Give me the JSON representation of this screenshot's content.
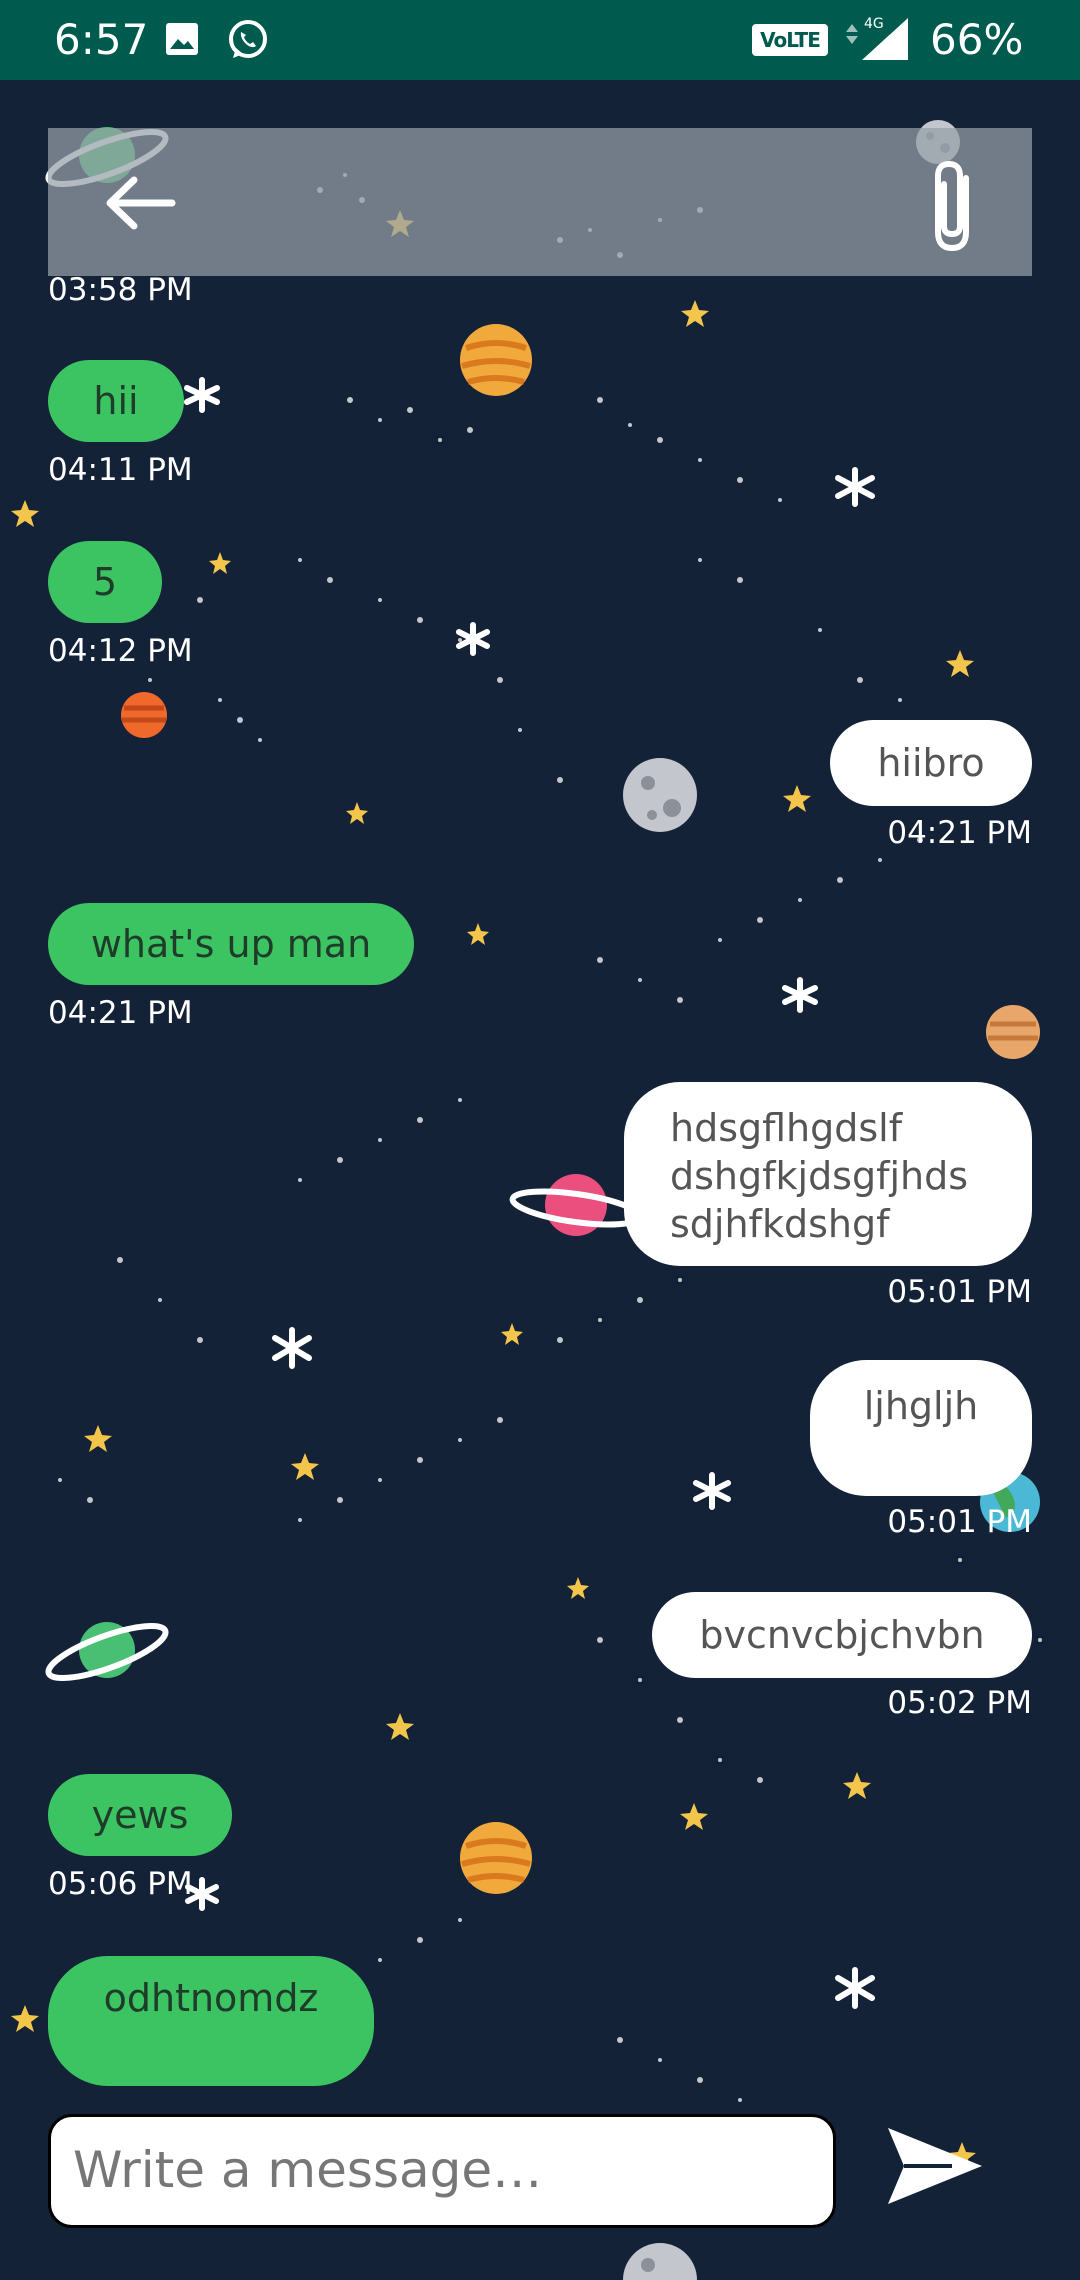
{
  "status_bar": {
    "time": "6:57",
    "network_badge": "VoLTE",
    "network_type": "4G",
    "battery": "66%",
    "icons": [
      "image-icon",
      "whatsapp-icon",
      "signal-icon"
    ]
  },
  "top_bar": {
    "icons": [
      "back-arrow-icon",
      "paperclip-attach-icon"
    ]
  },
  "messages": [
    {
      "id": "m0",
      "direction": "received",
      "text": "",
      "time": "03:58 PM"
    },
    {
      "id": "m1",
      "direction": "received",
      "text": "hii",
      "time": "04:11 PM"
    },
    {
      "id": "m2",
      "direction": "received",
      "text": "5",
      "time": "04:12 PM"
    },
    {
      "id": "m3",
      "direction": "sent",
      "text": "hiibro",
      "time": "04:21 PM"
    },
    {
      "id": "m4",
      "direction": "received",
      "text": "what's up man",
      "time": "04:21 PM"
    },
    {
      "id": "m5",
      "direction": "sent",
      "text": "hdsgflhgdslf dshgfkjdsgfjhds sdjhfkdshgf",
      "time": "05:01 PM"
    },
    {
      "id": "m6",
      "direction": "sent",
      "text": "ljhgljh",
      "time": "05:01 PM"
    },
    {
      "id": "m7",
      "direction": "sent",
      "text": "bvcnvcbjchvbn",
      "time": "05:02 PM"
    },
    {
      "id": "m8",
      "direction": "received",
      "text": "yews",
      "time": "05:06 PM"
    },
    {
      "id": "m9",
      "direction": "received",
      "text": "odhtnomdz",
      "time": ""
    }
  ],
  "composer": {
    "placeholder": "Write a message…",
    "send_icon": "send-icon"
  },
  "colors": {
    "status_bar": "#005b4f",
    "background": "#142238",
    "received_bubble": "#3cc463",
    "sent_bubble": "#ffffff",
    "top_bar": "#96a0a8"
  }
}
